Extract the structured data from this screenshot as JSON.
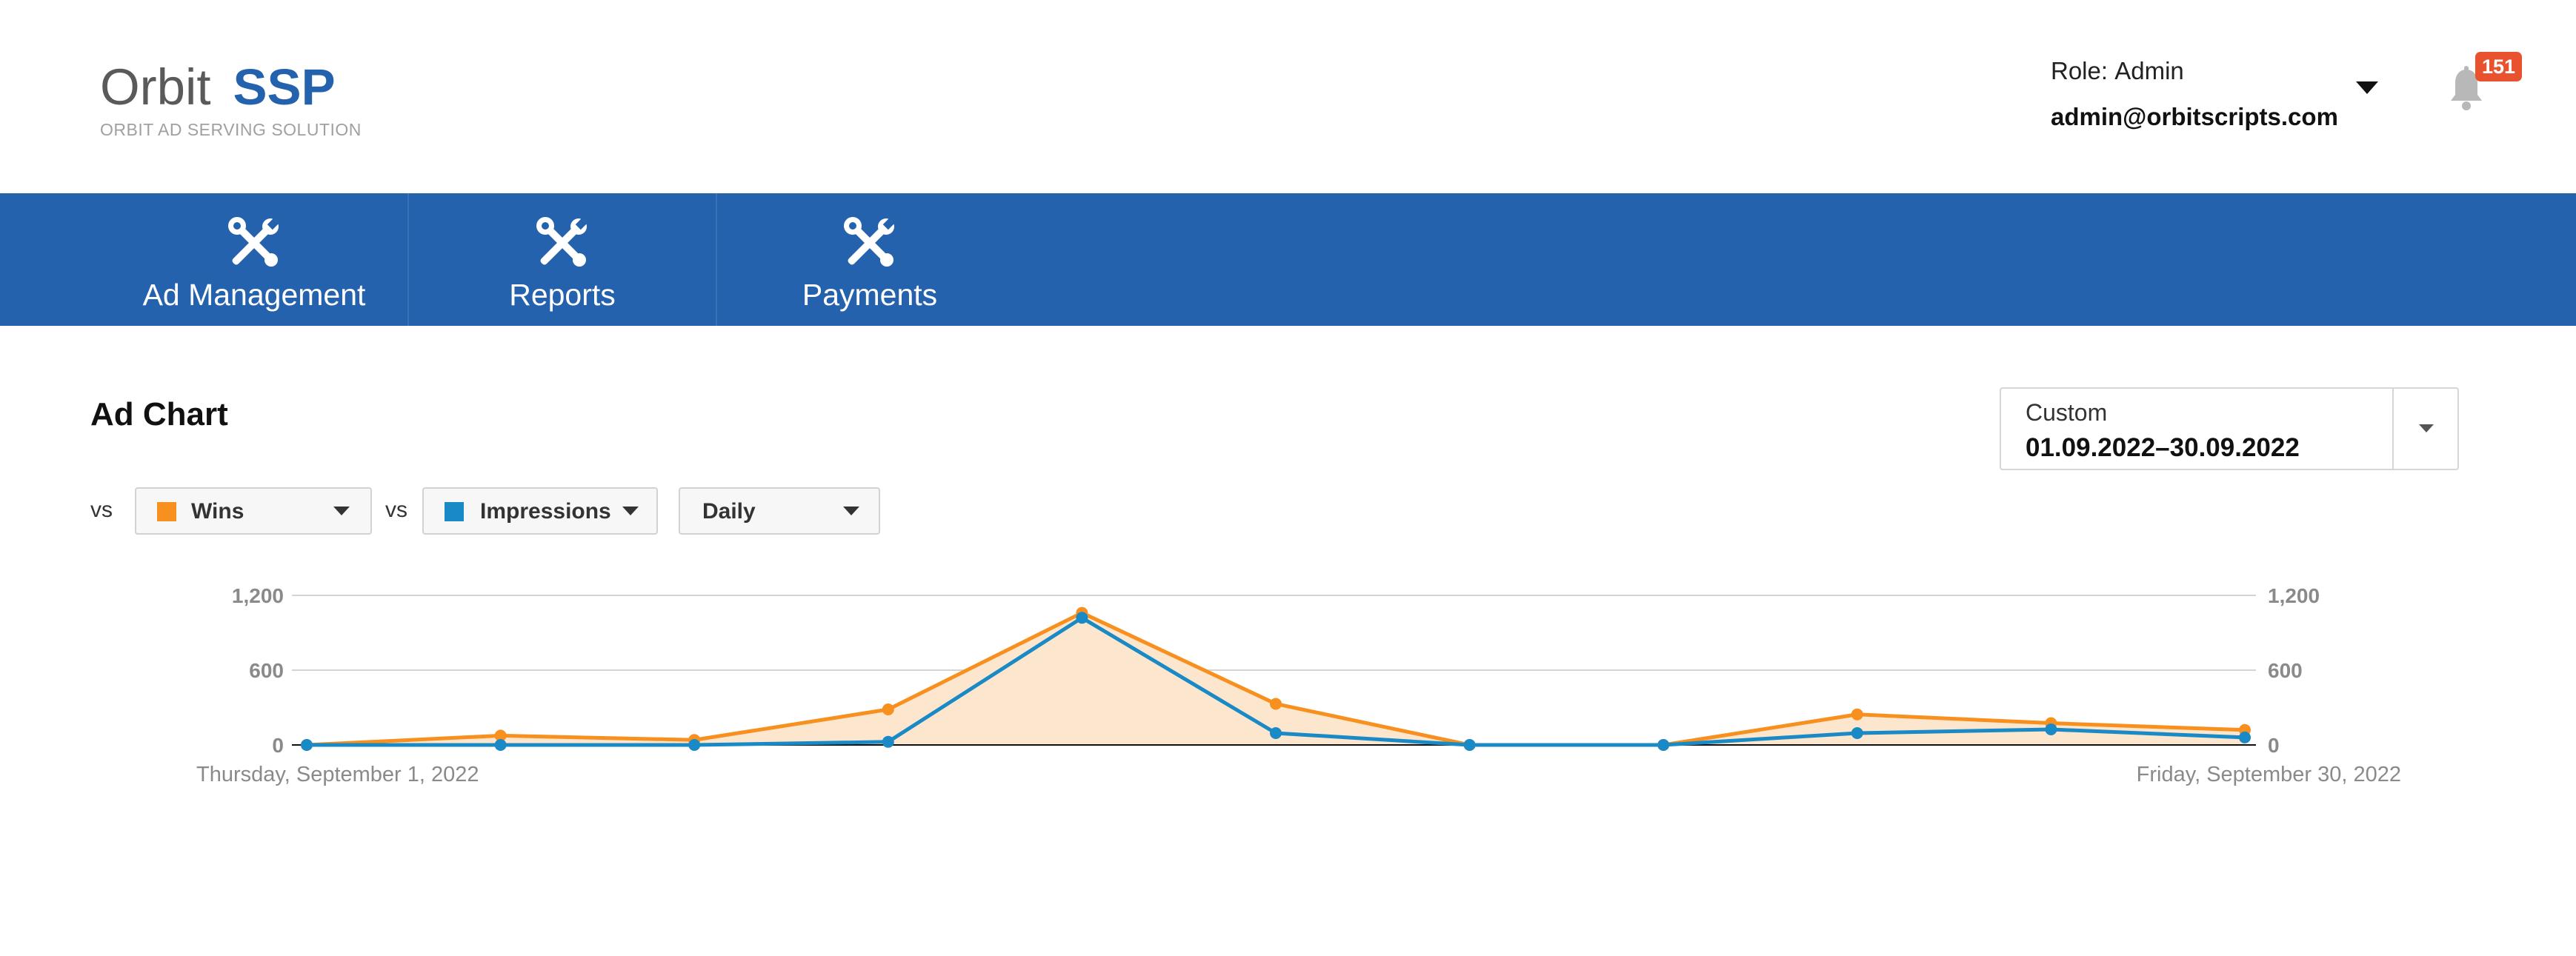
{
  "header": {
    "logo_word1": "Orbit",
    "logo_word2": "SSP",
    "logo_tagline": "ORBIT AD SERVING SOLUTION",
    "role_label": "Role:",
    "role_value": "Admin",
    "email": "admin@orbitscripts.com",
    "notification_count": "151",
    "icons": {
      "user_menu": "caret-down-icon",
      "notifications": "bell-icon"
    }
  },
  "nav": {
    "items": [
      {
        "label": "Ad Management",
        "icon": "tools-icon"
      },
      {
        "label": "Reports",
        "icon": "tools-icon"
      },
      {
        "label": "Payments",
        "icon": "tools-icon"
      }
    ]
  },
  "main": {
    "title": "Ad Chart",
    "date_range": {
      "preset": "Custom",
      "value": "01.09.2022–30.09.2022"
    },
    "controls": {
      "vs1": "vs",
      "metric1": "Wins",
      "vs2": "vs",
      "metric2": "Impressions",
      "granularity": "Daily"
    }
  },
  "colors": {
    "brand": "#2562ad",
    "wins": "#f7901e",
    "wins_fill": "#fde6ce",
    "impressions": "#1a8ac6",
    "badge": "#e8522f"
  },
  "chart_data": {
    "type": "area",
    "title": "",
    "x_start_label": "Thursday, September 1, 2022",
    "x_end_label": "Friday, September 30, 2022",
    "x_points": 11,
    "y_ticks_left": [
      "0",
      "600",
      "1,200"
    ],
    "y_ticks_right": [
      "0",
      "600",
      "1,200"
    ],
    "ylim": [
      0,
      1200
    ],
    "grid": true,
    "series": [
      {
        "name": "Wins",
        "values": [
          0,
          75,
          40,
          285,
          1060,
          330,
          0,
          0,
          245,
          175,
          120
        ]
      },
      {
        "name": "Impressions",
        "values": [
          0,
          0,
          0,
          25,
          1020,
          95,
          0,
          0,
          95,
          125,
          60
        ]
      }
    ]
  }
}
